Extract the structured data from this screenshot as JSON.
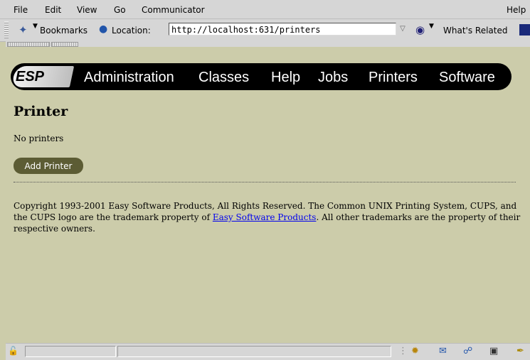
{
  "menubar": {
    "items": [
      "File",
      "Edit",
      "View",
      "Go",
      "Communicator"
    ],
    "help": "Help"
  },
  "toolbar": {
    "bookmarks_label": "Bookmarks",
    "location_label": "Location:",
    "location_value": "http://localhost:631/printers",
    "whats_related_label": "What's Related"
  },
  "navbar": {
    "logo": "ESP",
    "links": [
      "Administration",
      "Classes",
      "Help",
      "Jobs",
      "Printers",
      "Software"
    ]
  },
  "content": {
    "title": "Printer",
    "status": "No printers",
    "add_button": "Add Printer",
    "copyright_text_1": "Copyright 1993-2001 Easy Software Products, All Rights Reserved. The Common UNIX Printing System, CUPS, and the CUPS logo are the trademark property of ",
    "copyright_link": "Easy Software Products",
    "copyright_text_2": ". All other trademarks are the property of their respective owners."
  },
  "colors": {
    "page_bg": "#ccccaa",
    "navbar_bg": "#000000",
    "button_bg": "#5c5c34",
    "link": "#0000ee"
  },
  "icons": {
    "bookmarks": "bookmark-icon",
    "location": "location-icon",
    "whats_related": "whats-related-icon",
    "status_lock": "security-lock-icon"
  }
}
